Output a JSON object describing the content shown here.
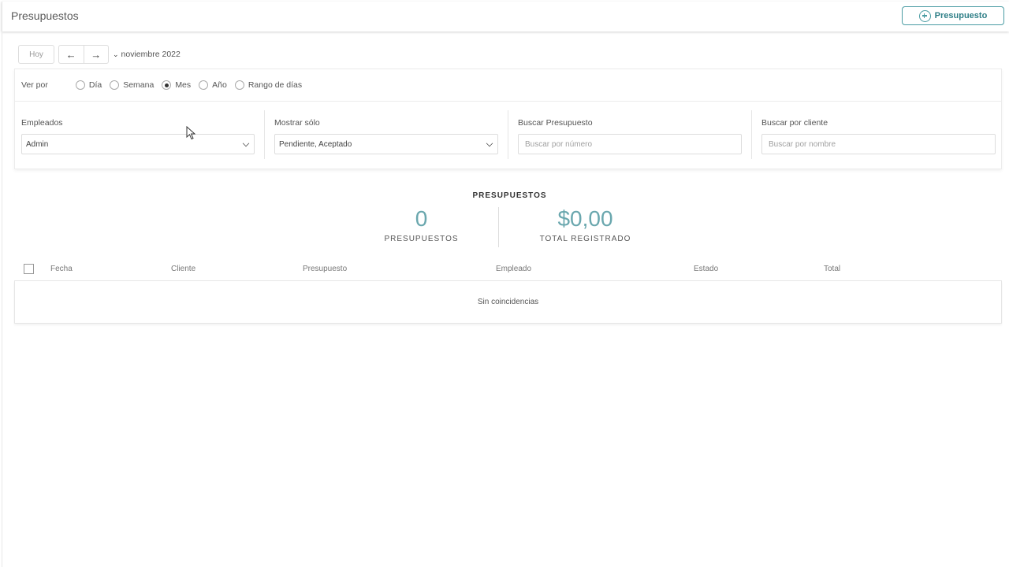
{
  "header": {
    "title": "Presupuestos",
    "new_button_label": "Presupuesto",
    "accent_color": "#4a9ca3"
  },
  "date_nav": {
    "today_label": "Hoy",
    "prev_icon": "arrow-left-icon",
    "next_icon": "arrow-right-icon",
    "prev_glyph": "←",
    "next_glyph": "→",
    "period_label": "noviembre 2022",
    "period_chevron": "⌄"
  },
  "view_by": {
    "label": "Ver por",
    "options": [
      {
        "label": "Día",
        "checked": false
      },
      {
        "label": "Semana",
        "checked": false
      },
      {
        "label": "Mes",
        "checked": true
      },
      {
        "label": "Año",
        "checked": false
      },
      {
        "label": "Rango de días",
        "checked": false
      }
    ]
  },
  "filters": {
    "employees": {
      "label": "Empleados",
      "value": "Admin"
    },
    "show_only": {
      "label": "Mostrar sólo",
      "value": "Pendiente, Aceptado"
    },
    "search_budget": {
      "label": "Buscar Presupuesto",
      "placeholder": "Buscar por número"
    },
    "search_client": {
      "label": "Buscar por cliente",
      "placeholder": "Buscar por nombre"
    }
  },
  "summary": {
    "title": "PRESUPUESTOS",
    "count_value": "0",
    "count_label": "PRESUPUESTOS",
    "total_value": "$0,00",
    "total_label": "TOTAL REGISTRADO",
    "value_color": "#6aa7ae"
  },
  "table": {
    "columns": [
      "Fecha",
      "Cliente",
      "Presupuesto",
      "Empleado",
      "Estado",
      "Total"
    ],
    "empty_message": "Sin coincidencias"
  }
}
